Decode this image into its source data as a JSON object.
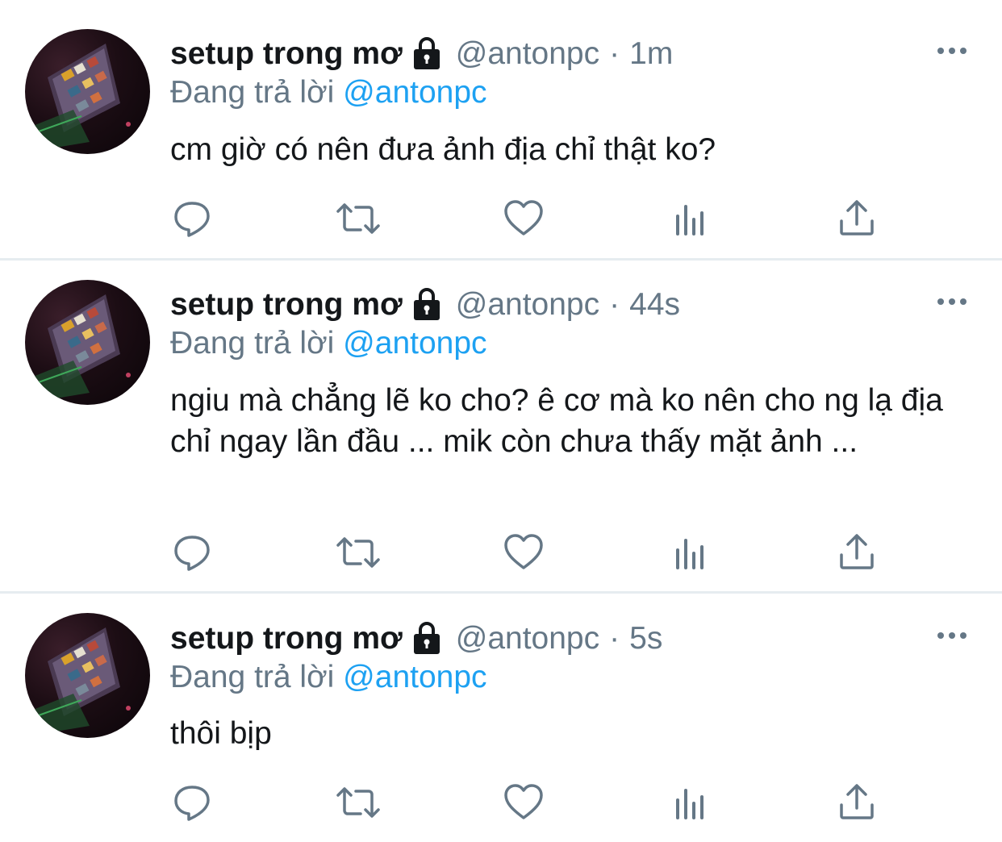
{
  "tweets": [
    {
      "name": "setup trong mơ",
      "handle": "@antonpc",
      "separator": "·",
      "time": "1m",
      "reply_prefix": "Đang trả lời",
      "reply_to": "@antonpc",
      "text": "cm giờ có nên đưa ảnh địa chỉ thật ko?"
    },
    {
      "name": "setup trong mơ",
      "handle": "@antonpc",
      "separator": "·",
      "time": "44s",
      "reply_prefix": "Đang trả lời",
      "reply_to": "@antonpc",
      "text": "ngiu mà chẳng lẽ ko cho? ê cơ mà ko nên cho ng lạ địa chỉ ngay lần đầu ... mik còn chưa thấy mặt ảnh ..."
    },
    {
      "name": "setup trong mơ",
      "handle": "@antonpc",
      "separator": "·",
      "time": "5s",
      "reply_prefix": "Đang trả lời",
      "reply_to": "@antonpc",
      "text": "thôi bịp"
    }
  ],
  "icons": {
    "protected": "lock-icon",
    "more": "more-icon",
    "reply": "reply-icon",
    "retweet": "retweet-icon",
    "like": "heart-icon",
    "analytics": "analytics-icon",
    "share": "share-icon"
  },
  "colors": {
    "text": "#14171a",
    "secondary": "#657786",
    "mention": "#1da1f2",
    "divider": "#e6ecf0",
    "icon": "#657786"
  }
}
